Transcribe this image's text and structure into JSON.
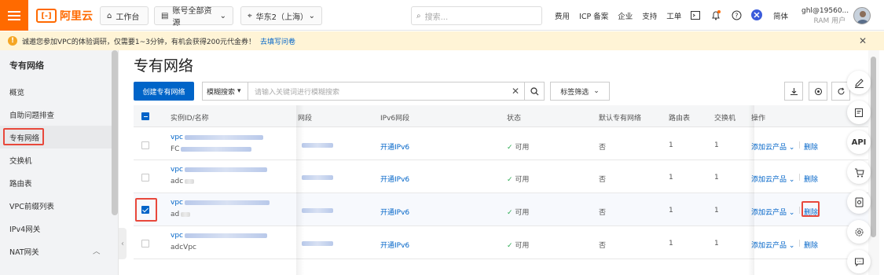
{
  "topbar": {
    "brand": "阿里云",
    "workbench": "工作台",
    "account_scope": "账号全部资源",
    "region": "华东2（上海）",
    "search_placeholder": "搜索...",
    "links": [
      "费用",
      "ICP 备案",
      "企业",
      "支持",
      "工单"
    ],
    "language": "简体",
    "user_name": "ghl@19560...",
    "user_role": "RAM 用户"
  },
  "banner": {
    "text": "诚邀您参加VPC的体验调研，仅需要1~3分钟，有机会获得200元代金券！",
    "link": "去填写问卷"
  },
  "sidebar": {
    "title": "专有网络",
    "items": [
      {
        "label": "概览"
      },
      {
        "label": "自助问题排查"
      },
      {
        "label": "专有网络",
        "active": true
      },
      {
        "label": "交换机"
      },
      {
        "label": "路由表"
      },
      {
        "label": "VPC前缀列表"
      },
      {
        "label": "IPv4网关"
      },
      {
        "label": "NAT网关"
      }
    ]
  },
  "main": {
    "title": "专有网络",
    "create_button": "创建专有网络",
    "search_mode": "模糊搜索",
    "search_placeholder": "请输入关键词进行模糊搜索",
    "tag_filter": "标签筛选"
  },
  "table": {
    "columns": [
      "实例ID/名称",
      "网段",
      "IPv6网段",
      "状态",
      "默认专有网络",
      "路由表",
      "交换机",
      "操作"
    ],
    "rows": [
      {
        "id_prefix": "vpc",
        "name_prefix": "FC",
        "ipv6": "开通IPv6",
        "status": "可用",
        "default": "否",
        "route_tables": "1",
        "vswitches": "1",
        "add_product": "添加云产品",
        "delete": "删除",
        "checked": false
      },
      {
        "id_prefix": "vpc",
        "name_prefix": "adc",
        "ipv6": "开通IPv6",
        "status": "可用",
        "default": "否",
        "route_tables": "1",
        "vswitches": "1",
        "add_product": "添加云产品",
        "delete": "删除",
        "checked": false
      },
      {
        "id_prefix": "vpc",
        "name_prefix": "ad",
        "ipv6": "开通IPv6",
        "status": "可用",
        "default": "否",
        "route_tables": "1",
        "vswitches": "1",
        "add_product": "添加云产品",
        "delete": "删除",
        "checked": true
      },
      {
        "id_prefix": "vpc",
        "name_prefix": "adcVpc",
        "ipv6": "开通IPv6",
        "status": "可用",
        "default": "否",
        "route_tables": "1",
        "vswitches": "1",
        "add_product": "添加云产品",
        "delete": "删除",
        "checked": false
      }
    ]
  },
  "rightbar": {
    "api_label": "API"
  },
  "colors": {
    "brand": "#ff6a00",
    "primary": "#0064c8",
    "highlight": "#e8483b",
    "success": "#2bab51"
  }
}
